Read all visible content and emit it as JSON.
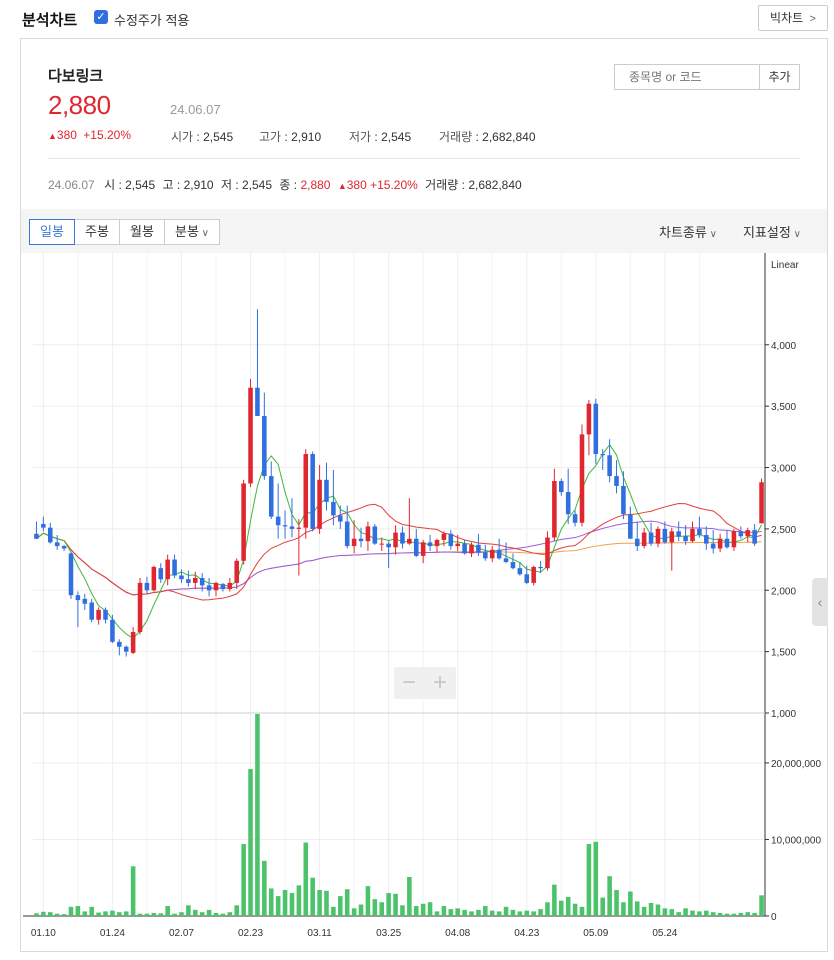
{
  "header": {
    "title": "분석차트",
    "adjusted_label": "수정주가 적용",
    "adjusted_checked": true,
    "big_chart_label": "빅차트"
  },
  "stock": {
    "name": "다보링크",
    "price": "2,880",
    "date": "24.06.07",
    "change": "380",
    "change_pct": "+15.20%",
    "open_label": "시가",
    "open": "2,545",
    "high_label": "고가",
    "high": "2,910",
    "low_label": "저가",
    "low": "2,545",
    "volume_label": "거래량",
    "volume": "2,682,840"
  },
  "search": {
    "placeholder": "종목명 or 코드",
    "add_label": "추가"
  },
  "info_line": {
    "date": "24.06.07",
    "open_label": "시",
    "open": "2,545",
    "high_label": "고",
    "high": "2,910",
    "low_label": "저",
    "low": "2,545",
    "close_label": "종",
    "close": "2,880",
    "change": "380",
    "change_pct": "+15.20%",
    "volume_label": "거래량",
    "volume": "2,682,840"
  },
  "toolbar": {
    "tabs": [
      "일봉",
      "주봉",
      "월봉",
      "분봉"
    ],
    "active_tab": "일봉",
    "chart_type_label": "차트종류",
    "indicator_label": "지표설정"
  },
  "colors": {
    "up": "#e0262f",
    "down": "#2f6fdf",
    "volume": "#4cc36b",
    "ma5": "#3db83a",
    "ma20": "#e0403a",
    "ma60": "#a05ae0",
    "ma120": "#f0a050"
  },
  "chart_data": {
    "type": "candlestick",
    "scale_label": "Linear",
    "price_ticks": [
      "4,000",
      "3,500",
      "3,000",
      "2,500",
      "2,000",
      "1,500",
      "1,000"
    ],
    "price_tick_values": [
      4000,
      3500,
      3000,
      2500,
      2000,
      1500,
      1000
    ],
    "price_range": [
      1000,
      4650
    ],
    "volume_ticks": [
      "20,000,000",
      "10,000,000",
      "0"
    ],
    "volume_tick_values": [
      20000000,
      10000000,
      0
    ],
    "volume_range": [
      0,
      26000000
    ],
    "x_labels": [
      "01.10",
      "01.24",
      "02.07",
      "02.23",
      "03.11",
      "03.25",
      "04.08",
      "04.23",
      "05.09",
      "05.24"
    ],
    "x_label_indices": [
      1,
      11,
      21,
      31,
      41,
      51,
      61,
      71,
      81,
      91
    ],
    "candles": [
      [
        2460,
        2560,
        2420,
        2420
      ],
      [
        2540,
        2600,
        2480,
        2510
      ],
      [
        2510,
        2550,
        2380,
        2390
      ],
      [
        2390,
        2450,
        2330,
        2360
      ],
      [
        2360,
        2370,
        2320,
        2340
      ],
      [
        2300,
        2310,
        1930,
        1960
      ],
      [
        1960,
        1990,
        1700,
        1920
      ],
      [
        1930,
        1970,
        1840,
        1890
      ],
      [
        1900,
        1930,
        1740,
        1760
      ],
      [
        1760,
        1860,
        1720,
        1840
      ],
      [
        1840,
        1860,
        1730,
        1760
      ],
      [
        1760,
        1800,
        1570,
        1580
      ],
      [
        1580,
        1600,
        1470,
        1540
      ],
      [
        1540,
        1550,
        1460,
        1500
      ],
      [
        1490,
        1700,
        1480,
        1660
      ],
      [
        1660,
        2100,
        1640,
        2060
      ],
      [
        2060,
        2110,
        1970,
        2000
      ],
      [
        2000,
        2200,
        1990,
        2190
      ],
      [
        2180,
        2220,
        2060,
        2090
      ],
      [
        2090,
        2290,
        2040,
        2250
      ],
      [
        2250,
        2290,
        2100,
        2120
      ],
      [
        2120,
        2170,
        2060,
        2090
      ],
      [
        2090,
        2160,
        2030,
        2060
      ],
      [
        2060,
        2150,
        2010,
        2100
      ],
      [
        2100,
        2140,
        1990,
        2040
      ],
      [
        2040,
        2100,
        1950,
        2000
      ],
      [
        2000,
        2070,
        1950,
        2060
      ],
      [
        2050,
        2060,
        1990,
        2010
      ],
      [
        2010,
        2100,
        1990,
        2060
      ],
      [
        2060,
        2260,
        2010,
        2240
      ],
      [
        2240,
        2900,
        2210,
        2870
      ],
      [
        2870,
        3720,
        2840,
        3650
      ],
      [
        3650,
        4290,
        3420,
        3420
      ],
      [
        3420,
        3610,
        2900,
        2930
      ],
      [
        2930,
        3050,
        2580,
        2600
      ],
      [
        2600,
        2870,
        2420,
        2530
      ],
      [
        2530,
        2650,
        2420,
        2520
      ],
      [
        2520,
        2750,
        2430,
        2500
      ],
      [
        2500,
        2580,
        2120,
        2510
      ],
      [
        2510,
        3150,
        2420,
        3110
      ],
      [
        3110,
        3130,
        2480,
        2500
      ],
      [
        2500,
        3020,
        2460,
        2900
      ],
      [
        2900,
        3040,
        2650,
        2720
      ],
      [
        2720,
        2980,
        2530,
        2610
      ],
      [
        2610,
        2690,
        2500,
        2560
      ],
      [
        2560,
        2690,
        2340,
        2360
      ],
      [
        2360,
        2570,
        2300,
        2420
      ],
      [
        2420,
        2510,
        2350,
        2400
      ],
      [
        2400,
        2560,
        2320,
        2520
      ],
      [
        2520,
        2540,
        2370,
        2380
      ],
      [
        2380,
        2430,
        2320,
        2380
      ],
      [
        2380,
        2400,
        2180,
        2350
      ],
      [
        2350,
        2530,
        2290,
        2470
      ],
      [
        2470,
        2520,
        2340,
        2380
      ],
      [
        2380,
        2750,
        2370,
        2420
      ],
      [
        2420,
        2500,
        2270,
        2280
      ],
      [
        2280,
        2410,
        2220,
        2390
      ],
      [
        2390,
        2450,
        2320,
        2360
      ],
      [
        2360,
        2420,
        2310,
        2410
      ],
      [
        2410,
        2480,
        2360,
        2460
      ],
      [
        2460,
        2490,
        2330,
        2360
      ],
      [
        2360,
        2450,
        2320,
        2380
      ],
      [
        2380,
        2410,
        2290,
        2300
      ],
      [
        2300,
        2390,
        2270,
        2370
      ],
      [
        2370,
        2460,
        2280,
        2310
      ],
      [
        2310,
        2370,
        2240,
        2260
      ],
      [
        2260,
        2360,
        2230,
        2330
      ],
      [
        2330,
        2420,
        2250,
        2260
      ],
      [
        2260,
        2390,
        2220,
        2230
      ],
      [
        2230,
        2300,
        2170,
        2180
      ],
      [
        2180,
        2230,
        2120,
        2130
      ],
      [
        2130,
        2200,
        2050,
        2060
      ],
      [
        2060,
        2200,
        2040,
        2190
      ],
      [
        2190,
        2240,
        2140,
        2180
      ],
      [
        2180,
        2480,
        2160,
        2430
      ],
      [
        2430,
        2990,
        2400,
        2890
      ],
      [
        2890,
        2910,
        2770,
        2800
      ],
      [
        2800,
        2990,
        2540,
        2620
      ],
      [
        2620,
        2650,
        2520,
        2550
      ],
      [
        2550,
        3350,
        2520,
        3270
      ],
      [
        3270,
        3550,
        3100,
        3520
      ],
      [
        3520,
        3560,
        3030,
        3110
      ],
      [
        3110,
        3150,
        2980,
        3100
      ],
      [
        3100,
        3230,
        2880,
        2930
      ],
      [
        2930,
        3060,
        2790,
        2850
      ],
      [
        2850,
        2970,
        2580,
        2620
      ],
      [
        2620,
        2680,
        2420,
        2420
      ],
      [
        2420,
        2560,
        2320,
        2360
      ],
      [
        2360,
        2510,
        2340,
        2470
      ],
      [
        2470,
        2550,
        2360,
        2380
      ],
      [
        2380,
        2520,
        2350,
        2500
      ],
      [
        2500,
        2560,
        2380,
        2390
      ],
      [
        2390,
        2510,
        2160,
        2480
      ],
      [
        2480,
        2560,
        2400,
        2440
      ],
      [
        2440,
        2530,
        2370,
        2400
      ],
      [
        2400,
        2560,
        2390,
        2500
      ],
      [
        2500,
        2600,
        2430,
        2450
      ],
      [
        2450,
        2520,
        2330,
        2380
      ],
      [
        2380,
        2490,
        2300,
        2340
      ],
      [
        2340,
        2460,
        2310,
        2420
      ],
      [
        2420,
        2490,
        2340,
        2350
      ],
      [
        2350,
        2500,
        2320,
        2480
      ],
      [
        2480,
        2520,
        2420,
        2440
      ],
      [
        2440,
        2510,
        2390,
        2490
      ],
      [
        2490,
        2540,
        2360,
        2380
      ],
      [
        2545,
        2910,
        2545,
        2880
      ]
    ],
    "volumes": [
      0.35,
      0.55,
      0.5,
      0.3,
      0.25,
      1.2,
      1.3,
      0.6,
      1.2,
      0.45,
      0.6,
      0.7,
      0.5,
      0.6,
      6.5,
      0.3,
      0.3,
      0.4,
      0.35,
      1.3,
      0.3,
      0.5,
      1.4,
      0.8,
      0.5,
      0.8,
      0.4,
      0.3,
      0.5,
      1.4,
      9.4,
      19.2,
      26.4,
      7.2,
      3.6,
      2.6,
      3.4,
      3.0,
      4.0,
      9.6,
      5.0,
      3.4,
      3.3,
      1.2,
      2.6,
      3.5,
      1.0,
      1.5,
      3.9,
      2.2,
      1.8,
      3.0,
      2.9,
      1.4,
      5.1,
      1.3,
      1.6,
      1.8,
      0.6,
      1.3,
      0.9,
      1.0,
      0.8,
      0.6,
      0.8,
      1.3,
      0.7,
      0.6,
      1.2,
      0.8,
      0.6,
      0.7,
      0.6,
      0.9,
      1.8,
      4.1,
      2.0,
      2.5,
      1.6,
      1.2,
      9.4,
      9.7,
      2.4,
      5.2,
      3.4,
      1.8,
      3.2,
      1.9,
      1.2,
      1.7,
      1.5,
      1.0,
      0.9,
      0.5,
      1.0,
      0.7,
      0.6,
      0.7,
      0.5,
      0.4,
      0.3,
      0.3,
      0.4,
      0.5,
      0.4,
      2.7
    ]
  }
}
